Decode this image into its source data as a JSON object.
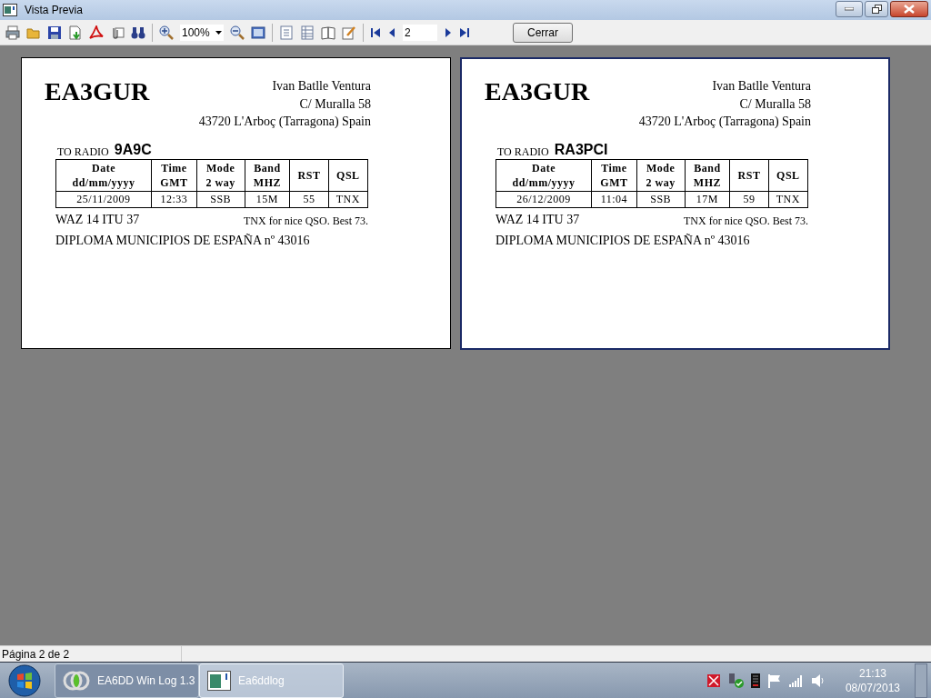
{
  "window": {
    "title": "Vista Previa"
  },
  "toolbar": {
    "zoom": "100%",
    "page": "2",
    "close_button": "Cerrar"
  },
  "pages": [
    {
      "selected": false,
      "callsign": "EA3GUR",
      "address": [
        "Ivan Batlle Ventura",
        "C/ Muralla 58",
        "43720 L'Arboç (Tarragona) Spain"
      ],
      "to_label": "TO RADIO",
      "to_call": "9A9C",
      "columns": [
        [
          "Date",
          "dd/mm/yyyy"
        ],
        [
          "Time",
          "GMT"
        ],
        [
          "Mode",
          "2 way"
        ],
        [
          "Band",
          "MHZ"
        ],
        [
          "RST"
        ],
        [
          "QSL"
        ]
      ],
      "row": [
        "25/11/2009",
        "12:33",
        "SSB",
        "15M",
        "55",
        "TNX"
      ],
      "zones": "WAZ 14 ITU 37",
      "thanks": "TNX for nice QSO. Best 73.",
      "diploma": "DIPLOMA MUNICIPIOS DE ESPAÑA nº 43016"
    },
    {
      "selected": true,
      "callsign": "EA3GUR",
      "address": [
        "Ivan Batlle Ventura",
        "C/ Muralla 58",
        "43720 L'Arboç (Tarragona) Spain"
      ],
      "to_label": "TO RADIO",
      "to_call": "RA3PCI",
      "columns": [
        [
          "Date",
          "dd/mm/yyyy"
        ],
        [
          "Time",
          "GMT"
        ],
        [
          "Mode",
          "2 way"
        ],
        [
          "Band",
          "MHZ"
        ],
        [
          "RST"
        ],
        [
          "QSL"
        ]
      ],
      "row": [
        "26/12/2009",
        "11:04",
        "SSB",
        "17M",
        "59",
        "TNX"
      ],
      "zones": "WAZ 14 ITU 37",
      "thanks": "TNX for nice QSO. Best 73.",
      "diploma": "DIPLOMA MUNICIPIOS DE ESPAÑA nº 43016"
    }
  ],
  "status_bar": "Página 2 de 2",
  "taskbar": {
    "items": [
      {
        "label": "EA6DD Win Log 1.3",
        "selected": false
      },
      {
        "label": "Ea6ddlog",
        "selected": true
      }
    ],
    "time": "21:13",
    "date": "08/07/2013"
  }
}
